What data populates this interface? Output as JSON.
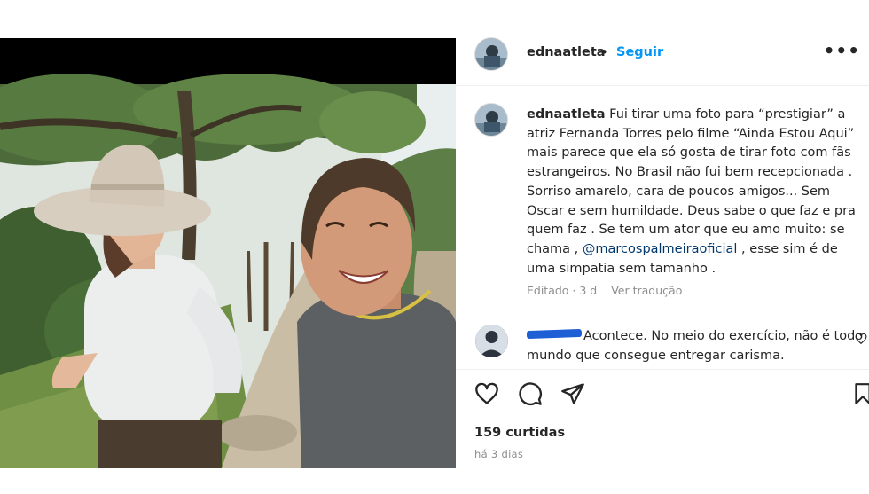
{
  "post": {
    "username": "ednaatleta",
    "separator": "•",
    "follow_label": "Seguir",
    "more_label": "•••",
    "caption_parts": {
      "p1": "Fui tirar uma foto para “prestigiar” a atriz Fernanda Torres pelo filme “Ainda Estou Aqui” mais parece que ela só gosta de tirar foto com fãs estrangeiros. No Brasil não fui bem recepcionada . Sorriso amarelo, cara de poucos amigos... Sem Oscar e sem humildade. Deus sabe o que faz e pra quem faz . Se tem um ator que eu amo muito: se chama , ",
      "mention": "@marcospalmeiraoficial",
      "p2": " , esse sim é de uma simpatia sem tamanho ."
    },
    "edited_label": "Editado · 3 d",
    "translate_label": "Ver tradução",
    "comment": {
      "text": "Acontece. No meio do exercício, não é todo mundo que consegue entregar carisma."
    },
    "icons": {
      "like": "heart-icon",
      "comment": "comment-icon",
      "share": "share-icon",
      "save": "bookmark-icon"
    },
    "likes_label": "159 curtidas",
    "time_label": "há 3 dias"
  },
  "colors": {
    "link_blue": "#0095f6",
    "mention_blue": "#00376b",
    "muted_gray": "#8e8e8e",
    "text": "#262626",
    "redaction_blue": "#1f5fd6"
  }
}
